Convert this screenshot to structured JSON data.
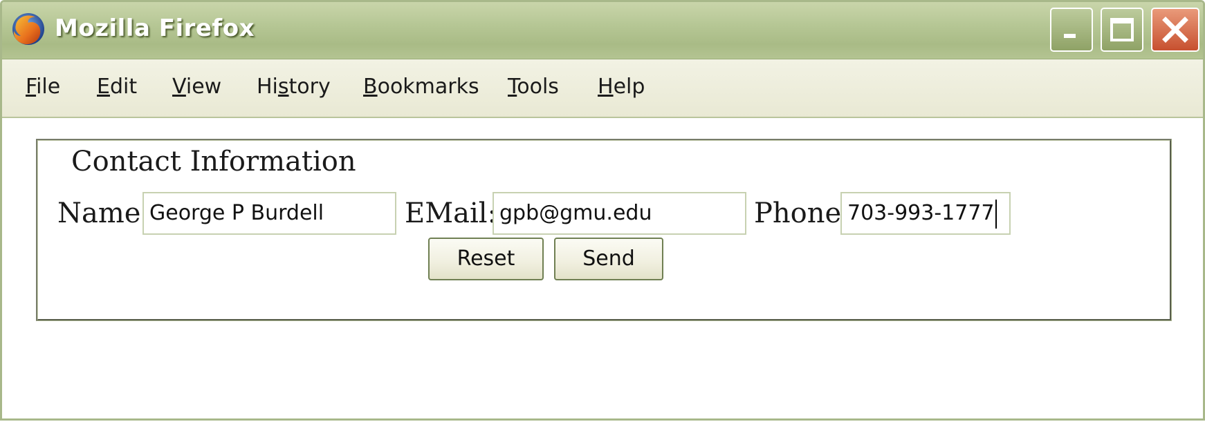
{
  "window": {
    "title": "Mozilla Firefox"
  },
  "menu": {
    "items": [
      {
        "pre": "",
        "ul": "F",
        "post": "ile"
      },
      {
        "pre": "",
        "ul": "E",
        "post": "dit"
      },
      {
        "pre": "",
        "ul": "V",
        "post": "iew"
      },
      {
        "pre": "Hi",
        "ul": "s",
        "post": "tory"
      },
      {
        "pre": "",
        "ul": "B",
        "post": "ookmarks"
      },
      {
        "pre": "",
        "ul": "T",
        "post": "ools"
      },
      {
        "pre": "",
        "ul": "H",
        "post": "elp"
      }
    ]
  },
  "form": {
    "legend": "Contact Information",
    "name_label": "Name:",
    "name_value": "George P Burdell",
    "email_label": "EMail:",
    "email_value": "gpb@gmu.edu",
    "phone_label": "Phone:",
    "phone_value": "703-993-1777",
    "reset_label": "Reset",
    "send_label": "Send"
  },
  "icons": {
    "app": "firefox-icon",
    "minimize": "minimize-icon",
    "maximize": "maximize-icon",
    "close": "close-icon"
  },
  "colors": {
    "titlebar": "#b6c795",
    "close_button": "#c7502f",
    "menubar": "#eeeedd"
  }
}
